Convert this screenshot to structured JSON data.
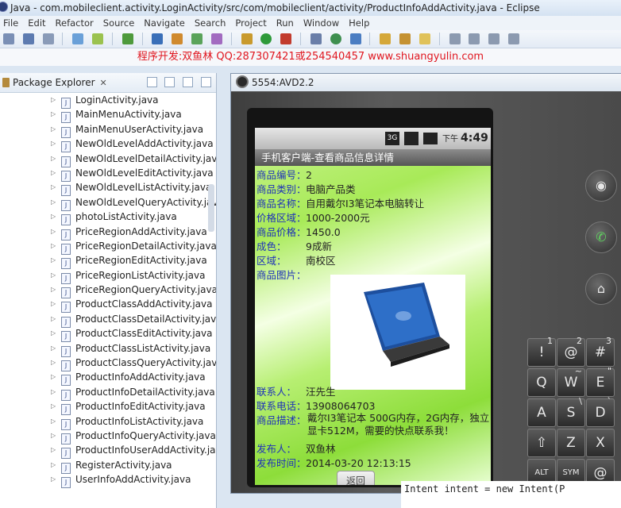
{
  "window": {
    "title": "Java - com.mobileclient.activity.LoginActivity/src/com/mobileclient/activity/ProductInfoAddActivity.java - Eclipse"
  },
  "menu": [
    "File",
    "Edit",
    "Refactor",
    "Source",
    "Navigate",
    "Search",
    "Project",
    "Run",
    "Window",
    "Help"
  ],
  "banner": {
    "text": "程序开发:双鱼林 QQ:287307421或254540457 www.shuangyulin.com"
  },
  "package_explorer": {
    "title": "Package Explorer",
    "close": "✕",
    "files": [
      "LoginActivity.java",
      "MainMenuActivity.java",
      "MainMenuUserActivity.java",
      "NewOldLevelAddActivity.java",
      "NewOldLevelDetailActivity.java",
      "NewOldLevelEditActivity.java",
      "NewOldLevelListActivity.java",
      "NewOldLevelQueryActivity.java",
      "photoListActivity.java",
      "PriceRegionAddActivity.java",
      "PriceRegionDetailActivity.java",
      "PriceRegionEditActivity.java",
      "PriceRegionListActivity.java",
      "PriceRegionQueryActivity.java",
      "ProductClassAddActivity.java",
      "ProductClassDetailActivity.java",
      "ProductClassEditActivity.java",
      "ProductClassListActivity.java",
      "ProductClassQueryActivity.java",
      "ProductInfoAddActivity.java",
      "ProductInfoDetailActivity.java",
      "ProductInfoEditActivity.java",
      "ProductInfoListActivity.java",
      "ProductInfoQueryActivity.java",
      "ProductInfoUserAddActivity.java",
      "RegisterActivity.java",
      "UserInfoAddActivity.java"
    ]
  },
  "emulator": {
    "title": "5554:AVD2.2",
    "status": {
      "network": "3G",
      "ampm": "下午",
      "time": "4:49"
    },
    "app_title": "手机客户端-查看商品信息详情",
    "fields": [
      {
        "label": "商品编号：",
        "value": "2"
      },
      {
        "label": "商品类别：",
        "value": "电脑产品类"
      },
      {
        "label": "商品名称：",
        "value": "自用戴尔I3笔记本电脑转让"
      },
      {
        "label": "价格区域：",
        "value": "1000-2000元"
      },
      {
        "label": "商品价格：",
        "value": "1450.0"
      },
      {
        "label": "成色：",
        "value": "9成新"
      },
      {
        "label": "区域：",
        "value": "南校区"
      },
      {
        "label": "商品图片：",
        "value": ""
      }
    ],
    "contact": {
      "label": "联系人：",
      "value": "汪先生"
    },
    "phone": {
      "label": "联系电话：",
      "value": "13908064703"
    },
    "desc": {
      "label": "商品描述：",
      "value": "戴尔I3笔记本 500G内存，2G内存，独立显卡512M，需要的快点联系我！"
    },
    "publisher": {
      "label": "发布人：",
      "value": "双鱼林"
    },
    "publish_time": {
      "label": "发布时间：",
      "value": "2014-03-20 12:13:15"
    },
    "back_button": "返回",
    "keys": [
      {
        "main": "!",
        "sup": "1"
      },
      {
        "main": "@",
        "sup": "2"
      },
      {
        "main": "#",
        "sup": "3"
      },
      {
        "main": "Q",
        "sup": ""
      },
      {
        "main": "W",
        "sup": "~"
      },
      {
        "main": "E",
        "sup": "\""
      },
      {
        "main": "A",
        "sup": ""
      },
      {
        "main": "S",
        "sup": "\\"
      },
      {
        "main": "D",
        "sup": "`"
      },
      {
        "main": "⇧",
        "sup": ""
      },
      {
        "main": "Z",
        "sup": ""
      },
      {
        "main": "X",
        "sup": ""
      },
      {
        "main": "ALT",
        "sup": ""
      },
      {
        "main": "SYM",
        "sup": ""
      },
      {
        "main": "@",
        "sup": ""
      }
    ]
  },
  "code_line": "Intent intent = new Intent(P"
}
